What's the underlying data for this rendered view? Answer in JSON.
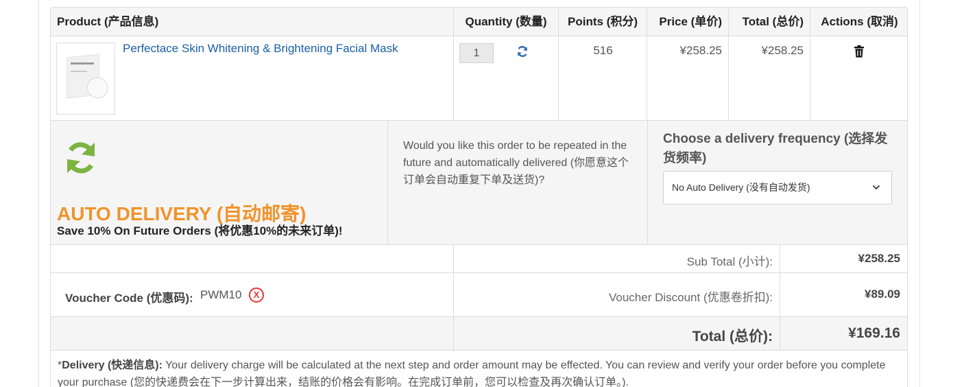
{
  "table": {
    "headers": {
      "product": "Product (产品信息)",
      "quantity": "Quantity (数量)",
      "points": "Points (积分)",
      "price": "Price (单价)",
      "total": "Total (总价)",
      "actions": "Actions (取消)"
    },
    "rows": [
      {
        "name": "Perfectace Skin Whitening & Brightening Facial Mask",
        "quantity": "1",
        "points": "516",
        "price": "¥258.25",
        "total": "¥258.25"
      }
    ]
  },
  "auto_delivery": {
    "title": "AUTO DELIVERY (自动邮寄)",
    "subtitle": "Save 10% On Future Orders (将优惠10%的未来订单)!",
    "question": "Would you like this order to be repeated in the future and automatically delivered (你愿意这个订单会自动重复下单及送货)?",
    "frequency_label": "Choose a delivery frequency (选择发货频率)",
    "frequency_selected": "No Auto Delivery (没有自动发货)"
  },
  "totals": {
    "subtotal_label": "Sub Total (小计):",
    "subtotal_value": "¥258.25",
    "voucher_label": "Voucher Code (优惠码):",
    "voucher_code": "PWM10",
    "voucher_remove": "X",
    "discount_label": "Voucher Discount (优惠卷折扣):",
    "discount_value": "¥89.09",
    "total_label": "Total (总价):",
    "total_value": "¥169.16"
  },
  "note": {
    "prefix": "*",
    "bold": "Delivery (快递信息):",
    "text": " Your delivery charge will be calculated at the next step and order amount may be effected. You can review and verify your order before you complete your purchase (您的快递费会在下一步计算出来，结账的价格会有影响。在完成订单前，您可以检查及再次确认订单。)."
  },
  "colors": {
    "accent_orange": "#f0932b",
    "accent_green": "#7cb342",
    "link_blue": "#1a5ea8",
    "remove_red": "#e33333"
  },
  "icons": [
    "refresh-icon",
    "trash-icon",
    "auto-delivery-icon",
    "chevron-down-icon",
    "remove-voucher-icon"
  ]
}
